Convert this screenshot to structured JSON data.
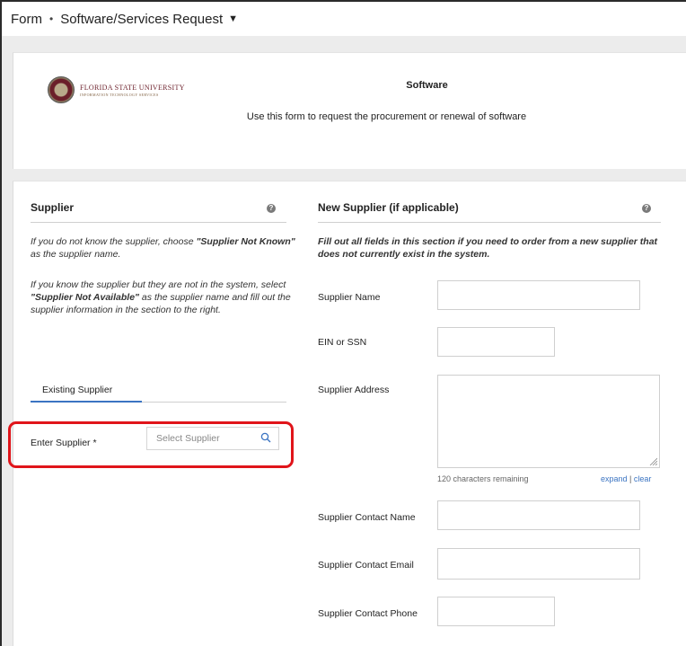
{
  "topbar": {
    "form_label": "Form",
    "separator": "•",
    "form_name": "Software/Services Request",
    "caret": "▼"
  },
  "header": {
    "logo_line1": "FLORIDA STATE UNIVERSITY",
    "logo_line2": "INFORMATION TECHNOLOGY SERVICES",
    "title": "Software",
    "description": "Use this form to request the procurement or renewal of software"
  },
  "supplier": {
    "title": "Supplier",
    "help": "?",
    "para1_a": "If you do not know the supplier, choose ",
    "para1_b": "\"Supplier Not Known\"",
    "para1_c": " as the supplier name.",
    "para2_a": "If you know the supplier but they are not in the system, select ",
    "para2_b": "\"Supplier Not Available\"",
    "para2_c": " as the supplier name and fill out the supplier information in the section to the right.",
    "tab_label": "Existing Supplier",
    "enter_label": "Enter Supplier",
    "required_mark": "*",
    "search_placeholder": "Select Supplier"
  },
  "new_supplier": {
    "title": "New Supplier (if applicable)",
    "help": "?",
    "instructions": "Fill out all fields in this section if you need to order from a new supplier that does not currently exist in the system.",
    "name_label": "Supplier Name",
    "ein_label": "EIN or SSN",
    "address_label": "Supplier Address",
    "chars_remaining": "120 characters remaining",
    "expand_link": "expand",
    "link_sep": "|",
    "clear_link": "clear",
    "contact_name_label": "Supplier Contact Name",
    "contact_email_label": "Supplier Contact Email",
    "contact_phone_label": "Supplier Contact Phone"
  },
  "colors": {
    "highlight": "#e0141a",
    "accent": "#3b74c2",
    "brand": "#6b1f2a"
  }
}
